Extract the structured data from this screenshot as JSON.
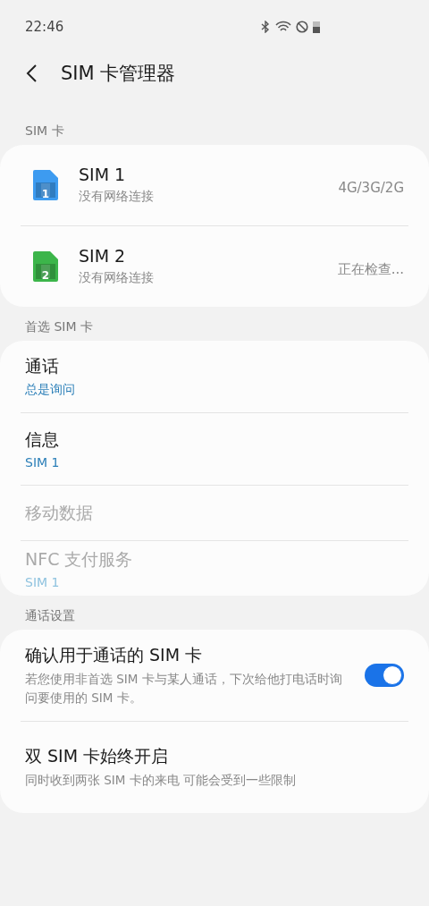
{
  "status_bar": {
    "time": "22:46"
  },
  "header": {
    "title": "SIM 卡管理器"
  },
  "sim_section": {
    "label": "SIM 卡",
    "cards": [
      {
        "name": "SIM 1",
        "status": "没有网络连接",
        "network": "4G/3G/2G",
        "number": "1",
        "color": "#3d9bf0"
      },
      {
        "name": "SIM 2",
        "status": "没有网络连接",
        "network": "正在检查...",
        "number": "2",
        "color": "#3cb54a"
      }
    ]
  },
  "preferred_section": {
    "label": "首选 SIM 卡",
    "items": [
      {
        "title": "通话",
        "value": "总是询问",
        "disabled": false
      },
      {
        "title": "信息",
        "value": "SIM 1",
        "disabled": false
      },
      {
        "title": "移动数据",
        "disabled": true
      },
      {
        "title": "NFC 支付服务",
        "value": "SIM 1",
        "disabled": true
      }
    ]
  },
  "call_section": {
    "label": "通话设置",
    "items": [
      {
        "kind": "switch",
        "title": "确认用于通话的 SIM 卡",
        "description": "若您使用非首选 SIM 卡与某人通话，下次给他打电话时询问要使用的 SIM 卡。",
        "on": true
      },
      {
        "kind": "plain",
        "title": "双 SIM 卡始终开启",
        "description": "同时收到两张 SIM 卡的来电 可能会受到一些限制"
      }
    ]
  }
}
